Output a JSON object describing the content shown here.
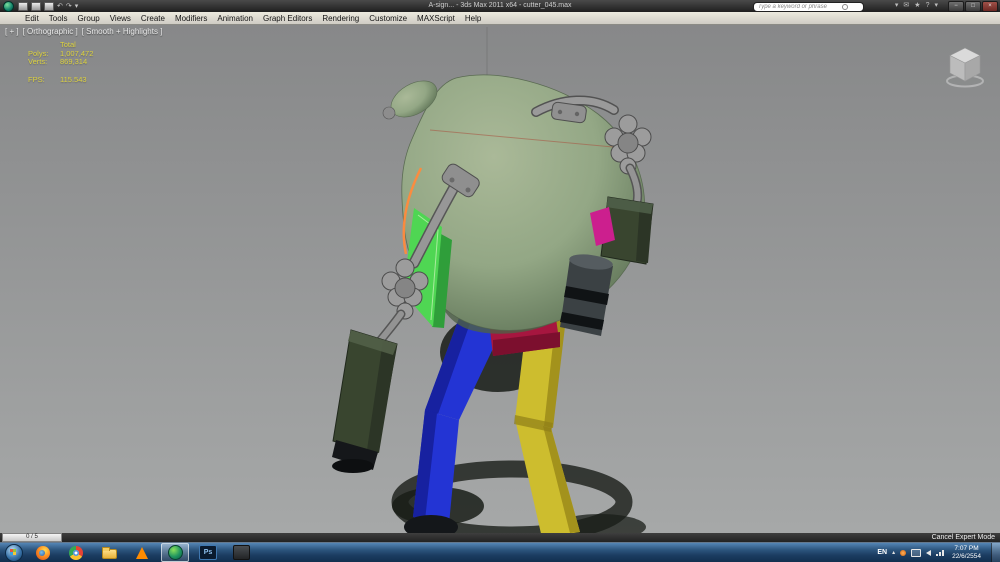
{
  "colors": {
    "titlebar_top": "#4a4a4a",
    "titlebar_bottom": "#1f1f1f",
    "menubar_bg": "#cfccc4",
    "viewport_top": "#878889",
    "viewport_bottom": "#a6a8a8",
    "stats_yellow": "#ddd23e",
    "body_green": "#93a785",
    "body_green_light": "#aab998",
    "body_green_dark": "#5e7356",
    "dark_green": "#39452f",
    "leg_blue": "#2334d4",
    "leg_blue_dark": "#1721a0",
    "leg_yellow": "#cdbd2e",
    "leg_yellow_dark": "#a3921c",
    "pelvis_red": "#a6163f",
    "magenta": "#cc1f8e",
    "strip_green": "#4fd653",
    "strip_green_dark": "#2f9e3a",
    "orange": "#ff8a3c",
    "shadow": "#191d18",
    "taskbar_top": "#5485b5",
    "taskbar_bottom": "#12304f"
  },
  "title_bar": {
    "title": "A-sign... - 3ds Max 2011 x64 - cutter_045.max",
    "search_placeholder": "Type a keyword or phrase",
    "icons": [
      "new-scene",
      "open-file",
      "save-file",
      "undo",
      "redo",
      "search",
      "communication-center",
      "favorites-star",
      "help"
    ],
    "help_glyph": "?",
    "star_glyph": "★",
    "mail_glyph": "✉",
    "dropdown_glyph": "▾",
    "undo_glyph": "↶",
    "redo_glyph": "↷",
    "window_buttons": {
      "minimize": "−",
      "maximize": "□",
      "close": "×"
    }
  },
  "menu_bar": {
    "items": [
      "Edit",
      "Tools",
      "Group",
      "Views",
      "Create",
      "Modifiers",
      "Animation",
      "Graph Editors",
      "Rendering",
      "Customize",
      "MAXScript",
      "Help"
    ]
  },
  "viewport": {
    "labels": {
      "plus": "[ + ]",
      "view": "[ Orthographic ]",
      "shading": "[ Smooth + Highlights ]"
    },
    "statistics": {
      "total_label": "Total",
      "polys_label": "Polys:",
      "polys_value": "1,007,472",
      "verts_label": "Verts:",
      "verts_value": "869,314",
      "fps_label": "FPS:",
      "fps_value": "115.543"
    }
  },
  "status_bar": {
    "frame_indicator": "0 / 5",
    "expert_mode_button": "Cancel Expert Mode"
  },
  "taskbar": {
    "apps": [
      "start",
      "firefox",
      "chrome",
      "windows-explorer",
      "vlc",
      "3ds-max",
      "photoshop",
      "dark-app"
    ],
    "active_app": "3ds-max",
    "photoshop_label": "Ps",
    "tray": {
      "language": "EN",
      "time": "7:07 PM",
      "date": "22/6/2554"
    }
  }
}
